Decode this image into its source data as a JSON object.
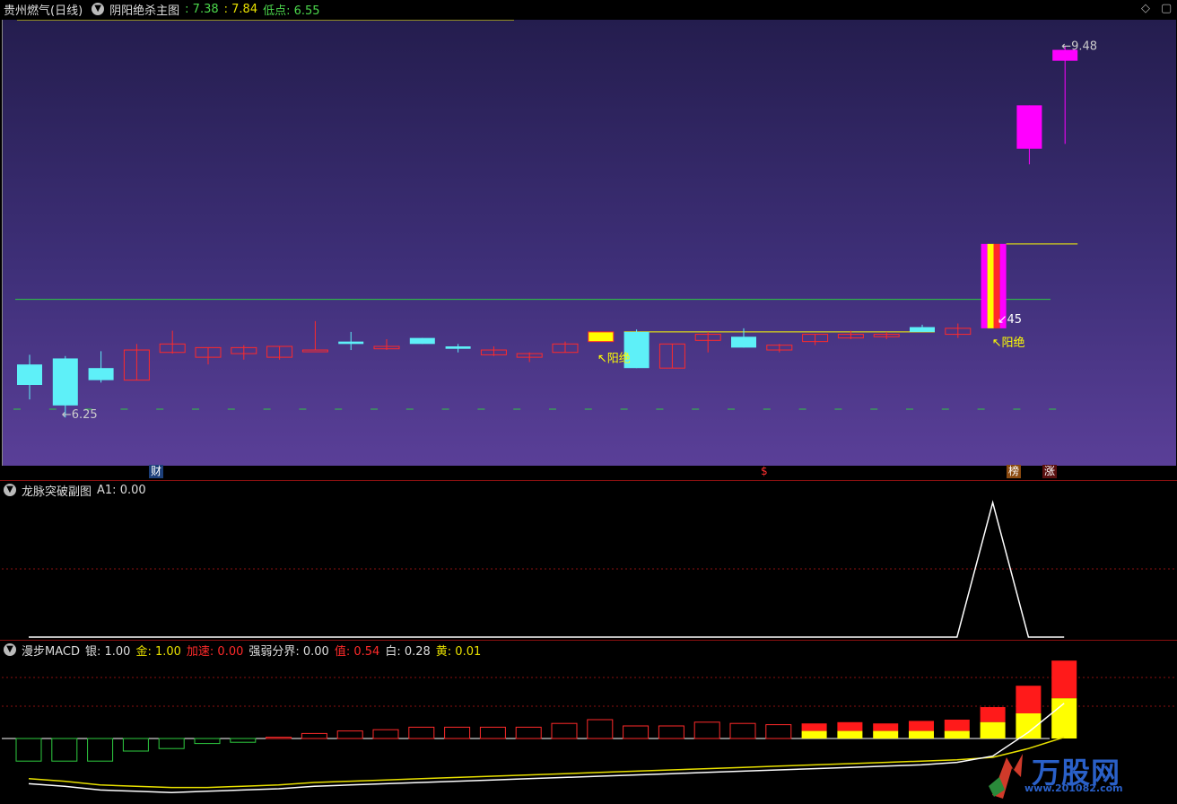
{
  "header": {
    "stock_title": "贵州燃气(日线)",
    "indicator_name": "阴阳绝杀主图",
    "values": [
      {
        "text": ": 7.38",
        "color": "#4cd84c"
      },
      {
        "text": ": 7.84",
        "color": "#e8e000"
      },
      {
        "text": "低点: 6.55",
        "color": "#4cd84c"
      }
    ]
  },
  "main_chart": {
    "price_range": [
      6.0,
      9.7
    ],
    "high_label": "9.48",
    "low_label": "6.25",
    "level_label": "45",
    "signal_label": "阳绝",
    "green_level": 7.38,
    "candles": [
      {
        "o": 6.84,
        "c": 6.67,
        "h": 6.92,
        "l": 6.55
      },
      {
        "o": 6.89,
        "c": 6.5,
        "h": 6.91,
        "l": 6.4
      },
      {
        "o": 6.81,
        "c": 6.71,
        "h": 6.95,
        "l": 6.69
      },
      {
        "o": 6.71,
        "c": 6.96,
        "h": 7.01,
        "l": 6.71
      },
      {
        "o": 6.94,
        "c": 7.01,
        "h": 7.12,
        "l": 6.93
      },
      {
        "o": 6.9,
        "c": 6.98,
        "h": 6.98,
        "l": 6.84
      },
      {
        "o": 6.93,
        "c": 6.98,
        "h": 7.0,
        "l": 6.88
      },
      {
        "o": 6.9,
        "c": 6.99,
        "h": 6.99,
        "l": 6.88
      },
      {
        "o": 6.96,
        "c": 6.96,
        "h": 7.2,
        "l": 6.96
      },
      {
        "o": 7.03,
        "c": 7.01,
        "h": 7.11,
        "l": 6.96
      },
      {
        "o": 6.97,
        "c": 6.99,
        "h": 7.05,
        "l": 6.96
      },
      {
        "o": 7.06,
        "c": 7.01,
        "h": 7.06,
        "l": 7.01
      },
      {
        "o": 6.99,
        "c": 6.97,
        "h": 7.01,
        "l": 6.94
      },
      {
        "o": 6.92,
        "c": 6.96,
        "h": 6.99,
        "l": 6.91
      },
      {
        "o": 6.9,
        "c": 6.93,
        "h": 6.94,
        "l": 6.86
      },
      {
        "o": 6.94,
        "c": 7.01,
        "h": 7.03,
        "l": 6.94
      },
      {
        "o": 7.03,
        "c": 7.11,
        "h": 7.11,
        "l": 7.03
      },
      {
        "o": 7.11,
        "c": 6.81,
        "h": 7.13,
        "l": 6.81
      },
      {
        "o": 6.81,
        "c": 7.01,
        "h": 7.01,
        "l": 6.81
      },
      {
        "o": 7.04,
        "c": 7.09,
        "h": 7.11,
        "l": 6.94
      },
      {
        "o": 7.07,
        "c": 6.98,
        "h": 7.14,
        "l": 6.98
      },
      {
        "o": 6.96,
        "c": 7.0,
        "h": 7.01,
        "l": 6.94
      },
      {
        "o": 7.03,
        "c": 7.09,
        "h": 7.09,
        "l": 7.0
      },
      {
        "o": 7.06,
        "c": 7.09,
        "h": 7.12,
        "l": 7.05
      },
      {
        "o": 7.07,
        "c": 7.09,
        "h": 7.11,
        "l": 7.05
      },
      {
        "o": 7.15,
        "c": 7.11,
        "h": 7.17,
        "l": 7.11
      },
      {
        "o": 7.09,
        "c": 7.14,
        "h": 7.18,
        "l": 7.06
      },
      {
        "o": 7.14,
        "c": 7.84,
        "h": 7.84,
        "l": 7.14
      },
      {
        "o": 8.63,
        "c": 8.99,
        "h": 8.99,
        "l": 8.5
      },
      {
        "o": 9.36,
        "c": 9.45,
        "h": 9.48,
        "l": 8.67
      }
    ]
  },
  "badges": [
    "财",
    "$",
    "榜",
    "涨"
  ],
  "sub_panel": {
    "title": "龙脉突破副图",
    "value": "A1: 0.00",
    "series": [
      0,
      0,
      0,
      0,
      0,
      0,
      0,
      0,
      0,
      0,
      0,
      0,
      0,
      0,
      0,
      0,
      0,
      0,
      0,
      0,
      0,
      0,
      0,
      0,
      0,
      0,
      0,
      1,
      0,
      0
    ]
  },
  "macd_panel": {
    "title": "漫步MACD",
    "values": [
      {
        "text": "银: 1.00",
        "color": "#ddd"
      },
      {
        "text": "金: 1.00",
        "color": "#e8e000"
      },
      {
        "text": "加速: 0.00",
        "color": "#ff2a2a"
      },
      {
        "text": "强弱分界: 0.00",
        "color": "#ddd"
      },
      {
        "text": "值: 0.54",
        "color": "#ff2a2a"
      },
      {
        "text": "白: 0.28",
        "color": "#ddd"
      },
      {
        "text": "黄: 0.01",
        "color": "#e8e000"
      }
    ],
    "bars": [
      -0.18,
      -0.18,
      -0.18,
      -0.1,
      -0.08,
      -0.04,
      -0.03,
      0.01,
      0.04,
      0.06,
      0.07,
      0.09,
      0.09,
      0.09,
      0.09,
      0.12,
      0.15,
      0.1,
      0.1,
      0.13,
      0.12,
      0.11,
      0.12,
      0.13,
      0.12,
      0.14,
      0.15,
      0.25,
      0.42,
      0.62
    ],
    "yellow_part": [
      0,
      0,
      0,
      0,
      0,
      0,
      0,
      0,
      0,
      0,
      0,
      0,
      0,
      0,
      0,
      0,
      0,
      0,
      0,
      0,
      0,
      0,
      0.06,
      0.06,
      0.06,
      0.06,
      0.06,
      0.13,
      0.2,
      0.32
    ],
    "white_line": [
      -0.36,
      -0.38,
      -0.41,
      -0.42,
      -0.43,
      -0.42,
      -0.41,
      -0.4,
      -0.38,
      -0.37,
      -0.36,
      -0.35,
      -0.34,
      -0.33,
      -0.32,
      -0.31,
      -0.3,
      -0.29,
      -0.28,
      -0.27,
      -0.26,
      -0.25,
      -0.24,
      -0.23,
      -0.22,
      -0.21,
      -0.19,
      -0.14,
      0.05,
      0.28
    ],
    "yellow_line": [
      -0.32,
      -0.34,
      -0.37,
      -0.38,
      -0.39,
      -0.39,
      -0.38,
      -0.37,
      -0.35,
      -0.34,
      -0.33,
      -0.32,
      -0.31,
      -0.3,
      -0.29,
      -0.28,
      -0.27,
      -0.26,
      -0.25,
      -0.24,
      -0.23,
      -0.22,
      -0.21,
      -0.2,
      -0.19,
      -0.18,
      -0.17,
      -0.15,
      -0.08,
      0.01
    ]
  },
  "watermark": {
    "title": "万股网",
    "url": "www.201082.com"
  },
  "colors": {
    "up": "#ff2a2a",
    "down": "#5ef0f8",
    "magenta": "#ff00ff",
    "yellow": "#ffff00",
    "green": "#2ecc40"
  }
}
